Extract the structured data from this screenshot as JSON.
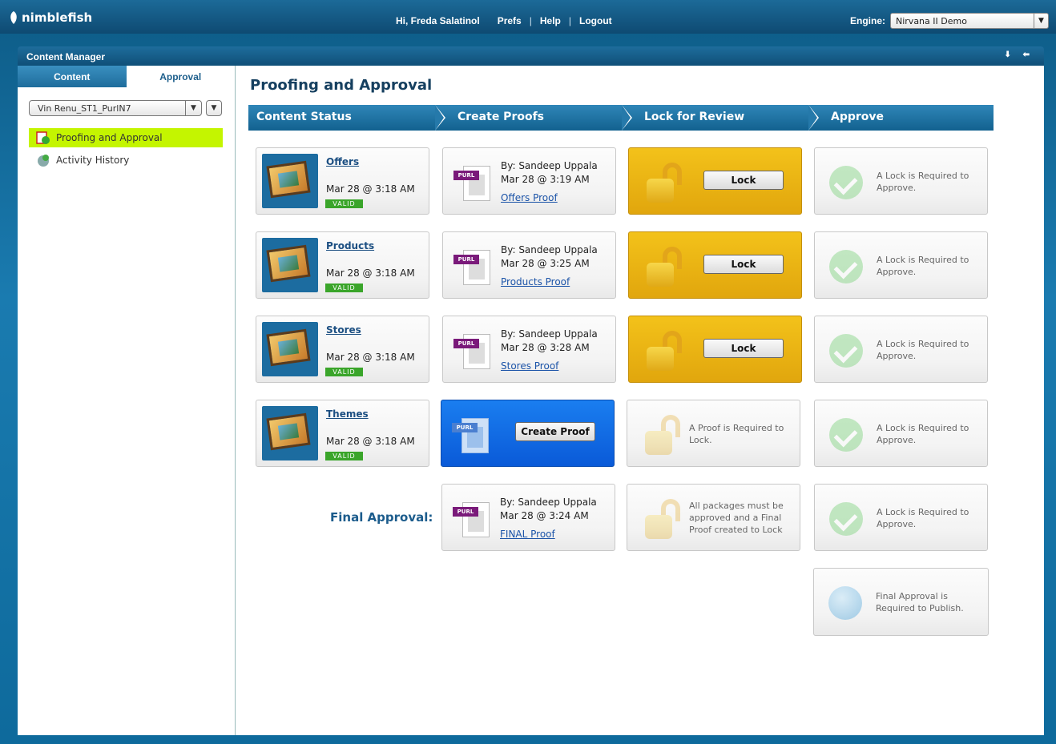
{
  "header": {
    "logo": "nimblefish",
    "greeting": "Hi, Freda Salatinol",
    "nav": [
      "Prefs",
      "Help",
      "Logout"
    ],
    "engine_label": "Engine:",
    "engine_value": "Nirvana II Demo"
  },
  "window": {
    "title": "Content Manager",
    "controls": "⬇ ⬅"
  },
  "sidebar": {
    "tabs": [
      "Content",
      "Approval"
    ],
    "project": "Vin Renu_ST1_PurlN7",
    "items": [
      "Proofing and Approval",
      "Activity History"
    ]
  },
  "main": {
    "title": "Proofing and Approval",
    "steps": [
      "Content Status",
      "Create Proofs",
      "Lock for Review",
      "Approve"
    ],
    "rows": [
      {
        "name": "Offers",
        "date": "Mar 28 @ 3:18 AM",
        "badge": "VALID",
        "proof_by": "By: Sandeep Uppala",
        "proof_date": "Mar 28 @ 3:19 AM",
        "proof_link": "Offers Proof",
        "lock_label": "Lock",
        "approve_text": "A Lock is Required to Approve."
      },
      {
        "name": "Products",
        "date": "Mar 28 @ 3:18 AM",
        "badge": "VALID",
        "proof_by": "By: Sandeep Uppala",
        "proof_date": "Mar 28 @ 3:25 AM",
        "proof_link": "Products Proof",
        "lock_label": "Lock",
        "approve_text": "A Lock is Required to Approve."
      },
      {
        "name": "Stores",
        "date": "Mar 28 @ 3:18 AM",
        "badge": "VALID",
        "proof_by": "By: Sandeep Uppala",
        "proof_date": "Mar 28 @ 3:28 AM",
        "proof_link": "Stores Proof",
        "lock_label": "Lock",
        "approve_text": "A Lock is Required to Approve."
      },
      {
        "name": "Themes",
        "date": "Mar 28 @ 3:18 AM",
        "badge": "VALID",
        "create_label": "Create Proof",
        "lock_text": "A Proof is Required to Lock.",
        "approve_text": "A Lock is Required to Approve."
      }
    ],
    "final": {
      "label": "Final Approval:",
      "proof_by": "By: Sandeep Uppala",
      "proof_date": "Mar 28 @ 3:24 AM",
      "proof_link": "FINAL Proof",
      "lock_text": "All packages must be approved and a Final Proof created to Lock",
      "approve_text": "A Lock is Required to Approve.",
      "publish_text": "Final Approval is Required to Publish."
    },
    "purl_tag": "PURL"
  }
}
